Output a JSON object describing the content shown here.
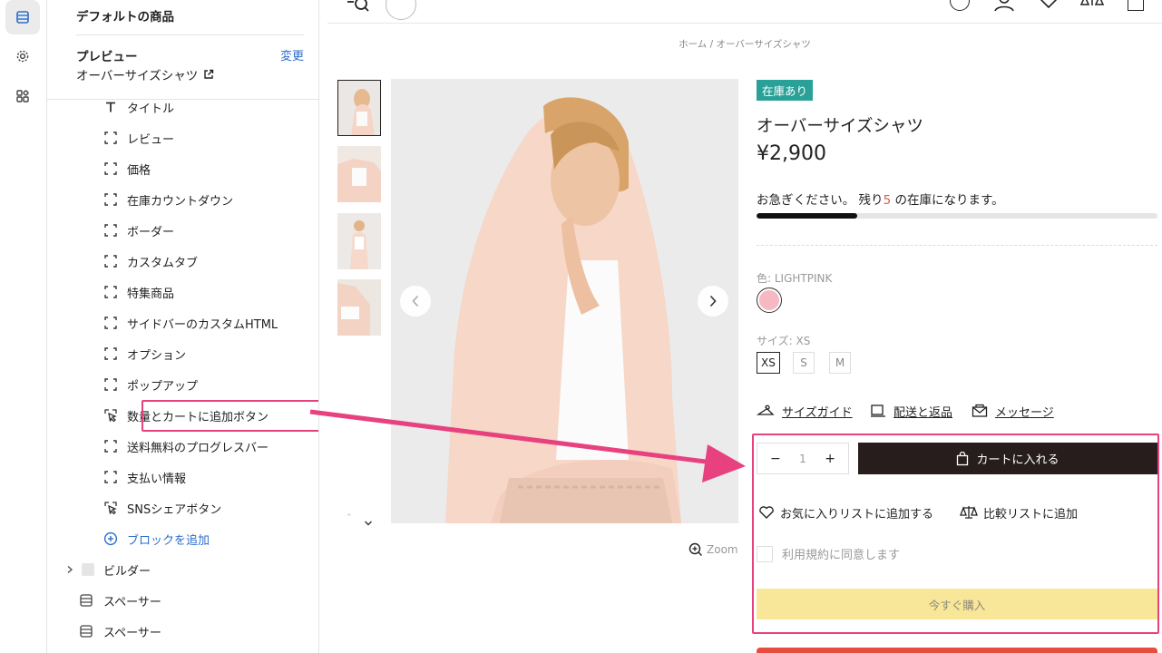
{
  "panel": {
    "title": "デフォルトの商品",
    "preview_label": "プレビュー",
    "change_label": "変更",
    "preview_value": "オーバーサイズシャツ",
    "blocks": [
      {
        "label": "タイトル",
        "icon": "text-icon"
      },
      {
        "label": "レビュー",
        "icon": "block-icon"
      },
      {
        "label": "価格",
        "icon": "block-icon"
      },
      {
        "label": "在庫カウントダウン",
        "icon": "block-icon"
      },
      {
        "label": "ボーダー",
        "icon": "block-icon"
      },
      {
        "label": "カスタムタブ",
        "icon": "block-icon"
      },
      {
        "label": "特集商品",
        "icon": "block-icon"
      },
      {
        "label": "サイドバーのカスタムHTML",
        "icon": "block-icon"
      },
      {
        "label": "オプション",
        "icon": "block-icon"
      },
      {
        "label": "ポップアップ",
        "icon": "block-icon"
      },
      {
        "label": "数量とカートに追加ボタン",
        "icon": "cursor-icon"
      },
      {
        "label": "送料無料のプログレスバー",
        "icon": "block-icon"
      },
      {
        "label": "支払い情報",
        "icon": "block-icon"
      },
      {
        "label": "SNSシェアボタン",
        "icon": "cursor-icon"
      }
    ],
    "add_block": "ブロックを追加",
    "sections": [
      {
        "label": "ビルダー",
        "icon": "chevron-right-icon"
      },
      {
        "label": "スペーサー",
        "icon": "spacer-icon"
      },
      {
        "label": "スペーサー",
        "icon": "spacer-icon"
      }
    ]
  },
  "store": {
    "breadcrumb": "ホーム  /  オーバーサイズシャツ",
    "stock_badge": "在庫あり",
    "product_title": "オーバーサイズシャツ",
    "price": "¥2,900",
    "hurry_prefix": "お急ぎください。 残り",
    "hurry_count": "5",
    "hurry_suffix": " の在庫になります。",
    "stock_level": 0.25,
    "color_label": "色: LIGHTPINK",
    "color_hex": "#f6b8c3",
    "size_label": "サイズ: XS",
    "sizes": [
      "XS",
      "S",
      "M"
    ],
    "selected_size": "XS",
    "links": {
      "size_guide": "サイズガイド",
      "shipping": "配送と返品",
      "message": "メッセージ"
    },
    "qty_minus": "−",
    "qty_value": "1",
    "qty_plus": "+",
    "cart_button": "カートに入れる",
    "wishlist": "お気に入りリストに追加する",
    "compare": "比較リストに追加",
    "terms": "利用規約に同意します",
    "buy_now": "今すぐ購入",
    "zoom": "Zoom"
  },
  "colors": {
    "highlight": "#e8417f",
    "badge": "#2aa198",
    "cart_button": "#271d1c",
    "buy_now": "#f8e798",
    "link_blue": "#2c6ecb"
  }
}
